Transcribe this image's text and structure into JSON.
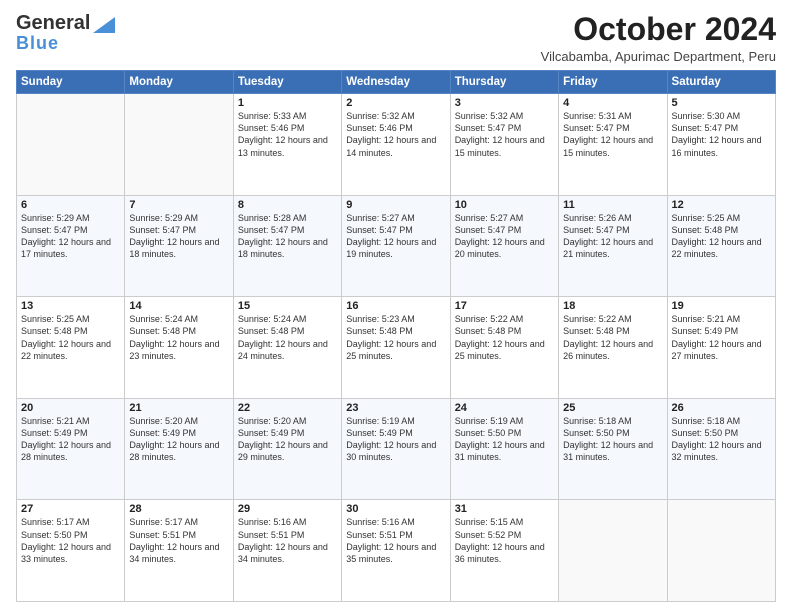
{
  "logo": {
    "line1": "General",
    "line2": "Blue"
  },
  "title": "October 2024",
  "subtitle": "Vilcabamba, Apurimac Department, Peru",
  "days_of_week": [
    "Sunday",
    "Monday",
    "Tuesday",
    "Wednesday",
    "Thursday",
    "Friday",
    "Saturday"
  ],
  "weeks": [
    [
      {
        "day": "",
        "sunrise": "",
        "sunset": "",
        "daylight": ""
      },
      {
        "day": "",
        "sunrise": "",
        "sunset": "",
        "daylight": ""
      },
      {
        "day": "1",
        "sunrise": "Sunrise: 5:33 AM",
        "sunset": "Sunset: 5:46 PM",
        "daylight": "Daylight: 12 hours and 13 minutes."
      },
      {
        "day": "2",
        "sunrise": "Sunrise: 5:32 AM",
        "sunset": "Sunset: 5:46 PM",
        "daylight": "Daylight: 12 hours and 14 minutes."
      },
      {
        "day": "3",
        "sunrise": "Sunrise: 5:32 AM",
        "sunset": "Sunset: 5:47 PM",
        "daylight": "Daylight: 12 hours and 15 minutes."
      },
      {
        "day": "4",
        "sunrise": "Sunrise: 5:31 AM",
        "sunset": "Sunset: 5:47 PM",
        "daylight": "Daylight: 12 hours and 15 minutes."
      },
      {
        "day": "5",
        "sunrise": "Sunrise: 5:30 AM",
        "sunset": "Sunset: 5:47 PM",
        "daylight": "Daylight: 12 hours and 16 minutes."
      }
    ],
    [
      {
        "day": "6",
        "sunrise": "Sunrise: 5:29 AM",
        "sunset": "Sunset: 5:47 PM",
        "daylight": "Daylight: 12 hours and 17 minutes."
      },
      {
        "day": "7",
        "sunrise": "Sunrise: 5:29 AM",
        "sunset": "Sunset: 5:47 PM",
        "daylight": "Daylight: 12 hours and 18 minutes."
      },
      {
        "day": "8",
        "sunrise": "Sunrise: 5:28 AM",
        "sunset": "Sunset: 5:47 PM",
        "daylight": "Daylight: 12 hours and 18 minutes."
      },
      {
        "day": "9",
        "sunrise": "Sunrise: 5:27 AM",
        "sunset": "Sunset: 5:47 PM",
        "daylight": "Daylight: 12 hours and 19 minutes."
      },
      {
        "day": "10",
        "sunrise": "Sunrise: 5:27 AM",
        "sunset": "Sunset: 5:47 PM",
        "daylight": "Daylight: 12 hours and 20 minutes."
      },
      {
        "day": "11",
        "sunrise": "Sunrise: 5:26 AM",
        "sunset": "Sunset: 5:47 PM",
        "daylight": "Daylight: 12 hours and 21 minutes."
      },
      {
        "day": "12",
        "sunrise": "Sunrise: 5:25 AM",
        "sunset": "Sunset: 5:48 PM",
        "daylight": "Daylight: 12 hours and 22 minutes."
      }
    ],
    [
      {
        "day": "13",
        "sunrise": "Sunrise: 5:25 AM",
        "sunset": "Sunset: 5:48 PM",
        "daylight": "Daylight: 12 hours and 22 minutes."
      },
      {
        "day": "14",
        "sunrise": "Sunrise: 5:24 AM",
        "sunset": "Sunset: 5:48 PM",
        "daylight": "Daylight: 12 hours and 23 minutes."
      },
      {
        "day": "15",
        "sunrise": "Sunrise: 5:24 AM",
        "sunset": "Sunset: 5:48 PM",
        "daylight": "Daylight: 12 hours and 24 minutes."
      },
      {
        "day": "16",
        "sunrise": "Sunrise: 5:23 AM",
        "sunset": "Sunset: 5:48 PM",
        "daylight": "Daylight: 12 hours and 25 minutes."
      },
      {
        "day": "17",
        "sunrise": "Sunrise: 5:22 AM",
        "sunset": "Sunset: 5:48 PM",
        "daylight": "Daylight: 12 hours and 25 minutes."
      },
      {
        "day": "18",
        "sunrise": "Sunrise: 5:22 AM",
        "sunset": "Sunset: 5:48 PM",
        "daylight": "Daylight: 12 hours and 26 minutes."
      },
      {
        "day": "19",
        "sunrise": "Sunrise: 5:21 AM",
        "sunset": "Sunset: 5:49 PM",
        "daylight": "Daylight: 12 hours and 27 minutes."
      }
    ],
    [
      {
        "day": "20",
        "sunrise": "Sunrise: 5:21 AM",
        "sunset": "Sunset: 5:49 PM",
        "daylight": "Daylight: 12 hours and 28 minutes."
      },
      {
        "day": "21",
        "sunrise": "Sunrise: 5:20 AM",
        "sunset": "Sunset: 5:49 PM",
        "daylight": "Daylight: 12 hours and 28 minutes."
      },
      {
        "day": "22",
        "sunrise": "Sunrise: 5:20 AM",
        "sunset": "Sunset: 5:49 PM",
        "daylight": "Daylight: 12 hours and 29 minutes."
      },
      {
        "day": "23",
        "sunrise": "Sunrise: 5:19 AM",
        "sunset": "Sunset: 5:49 PM",
        "daylight": "Daylight: 12 hours and 30 minutes."
      },
      {
        "day": "24",
        "sunrise": "Sunrise: 5:19 AM",
        "sunset": "Sunset: 5:50 PM",
        "daylight": "Daylight: 12 hours and 31 minutes."
      },
      {
        "day": "25",
        "sunrise": "Sunrise: 5:18 AM",
        "sunset": "Sunset: 5:50 PM",
        "daylight": "Daylight: 12 hours and 31 minutes."
      },
      {
        "day": "26",
        "sunrise": "Sunrise: 5:18 AM",
        "sunset": "Sunset: 5:50 PM",
        "daylight": "Daylight: 12 hours and 32 minutes."
      }
    ],
    [
      {
        "day": "27",
        "sunrise": "Sunrise: 5:17 AM",
        "sunset": "Sunset: 5:50 PM",
        "daylight": "Daylight: 12 hours and 33 minutes."
      },
      {
        "day": "28",
        "sunrise": "Sunrise: 5:17 AM",
        "sunset": "Sunset: 5:51 PM",
        "daylight": "Daylight: 12 hours and 34 minutes."
      },
      {
        "day": "29",
        "sunrise": "Sunrise: 5:16 AM",
        "sunset": "Sunset: 5:51 PM",
        "daylight": "Daylight: 12 hours and 34 minutes."
      },
      {
        "day": "30",
        "sunrise": "Sunrise: 5:16 AM",
        "sunset": "Sunset: 5:51 PM",
        "daylight": "Daylight: 12 hours and 35 minutes."
      },
      {
        "day": "31",
        "sunrise": "Sunrise: 5:15 AM",
        "sunset": "Sunset: 5:52 PM",
        "daylight": "Daylight: 12 hours and 36 minutes."
      },
      {
        "day": "",
        "sunrise": "",
        "sunset": "",
        "daylight": ""
      },
      {
        "day": "",
        "sunrise": "",
        "sunset": "",
        "daylight": ""
      }
    ]
  ],
  "colors": {
    "header_bg": "#3a6fb5",
    "header_text": "#ffffff",
    "accent": "#4a90d9"
  }
}
